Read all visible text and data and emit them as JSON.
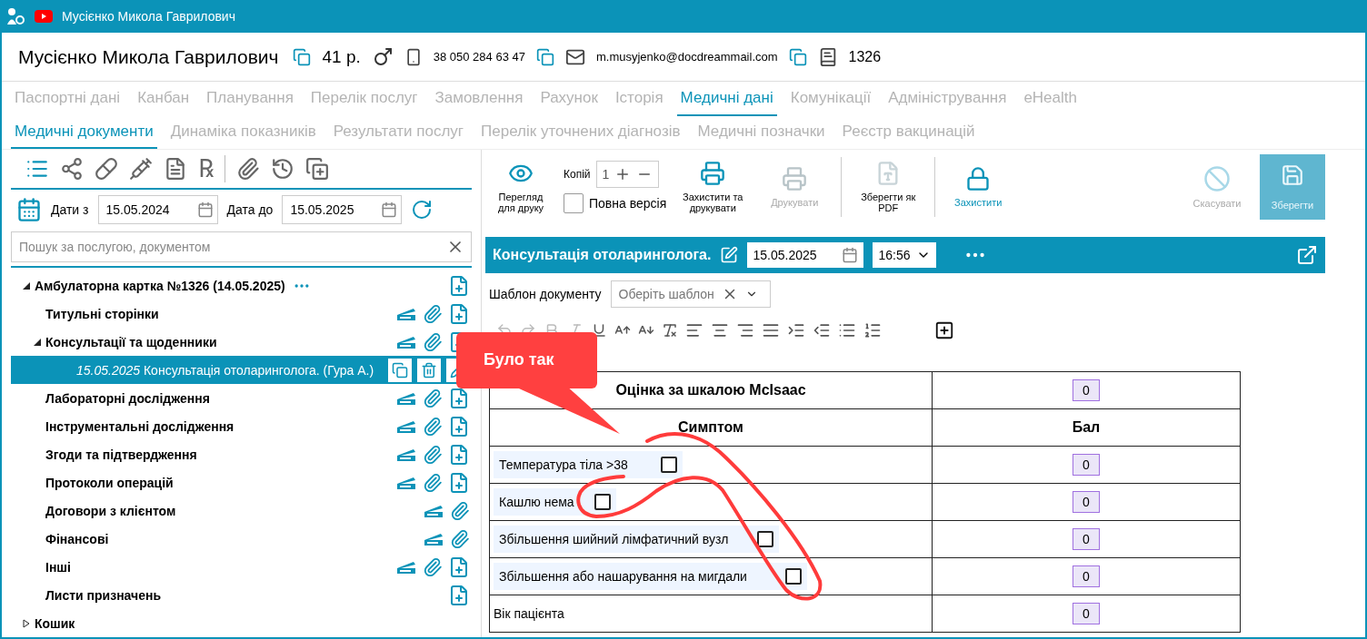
{
  "window": {
    "title": "Мусієнко Микола Гаврилович"
  },
  "patient": {
    "name": "Мусієнко Микола Гаврилович",
    "age": "41 р.",
    "phone": "38 050 284 63 47",
    "email": "m.musyjenko@docdreammail.com",
    "card": "1326"
  },
  "tabs": [
    {
      "label": "Паспортні дані",
      "selected": false
    },
    {
      "label": "Канбан",
      "selected": false
    },
    {
      "label": "Планування",
      "selected": false
    },
    {
      "label": "Перелік послуг",
      "selected": false
    },
    {
      "label": "Замовлення",
      "selected": false
    },
    {
      "label": "Рахунок",
      "selected": false
    },
    {
      "label": "Історія",
      "selected": false
    },
    {
      "label": "Медичні дані",
      "selected": true
    },
    {
      "label": "Комунікації",
      "selected": false
    },
    {
      "label": "Адміністрування",
      "selected": false
    },
    {
      "label": "eHealth",
      "selected": false
    }
  ],
  "subtabs": [
    {
      "label": "Медичні документи",
      "selected": true
    },
    {
      "label": "Динаміка показників",
      "selected": false
    },
    {
      "label": "Результати послуг",
      "selected": false
    },
    {
      "label": "Перелік уточнених діагнозів",
      "selected": false
    },
    {
      "label": "Медичні позначки",
      "selected": false
    },
    {
      "label": "Реєстр вакцинацій",
      "selected": false
    }
  ],
  "left_toolbar": {
    "prescription_symbol": "℞"
  },
  "date_filter": {
    "from_label": "Дати з",
    "from": "15.05.2024",
    "to_label": "Дата до",
    "to": "15.05.2025"
  },
  "search": {
    "placeholder": "Пошук за послугою, документом"
  },
  "tree": [
    {
      "kind": "root",
      "label": "Амбулаторна картка №1326 (14.05.2025)",
      "expanded": true,
      "selected": false,
      "children": [
        {
          "kind": "category",
          "label": "Титульні сторінки",
          "selected": false
        },
        {
          "kind": "category",
          "label": "Консультації та щоденники",
          "selected": false,
          "expanded": true,
          "children": [
            {
              "kind": "record",
              "date": "15.05.2025",
              "label": "Консультація отоларинголога. (Гура А.)",
              "selected": true
            }
          ]
        },
        {
          "kind": "category",
          "label": "Лабораторні дослідження",
          "selected": false
        },
        {
          "kind": "category",
          "label": "Інструментальні дослідження",
          "selected": false
        },
        {
          "kind": "category",
          "label": "Згоди та підтвердження",
          "selected": false
        },
        {
          "kind": "category",
          "label": "Протоколи операцій",
          "selected": false
        },
        {
          "kind": "archive",
          "label": "Договори з клієнтом",
          "selected": false
        },
        {
          "kind": "archive",
          "label": "Фінансові",
          "selected": false
        },
        {
          "kind": "category",
          "label": "Інші",
          "selected": false
        },
        {
          "kind": "list",
          "label": "Листи призначень",
          "selected": false
        }
      ]
    },
    {
      "kind": "trash",
      "label": "Кошик",
      "expanded": false,
      "selected": false
    }
  ],
  "doc_toolbar": {
    "preview": {
      "label": "Перегляд для друку",
      "disabled": false
    },
    "copies": {
      "label": "Копій",
      "value": "1"
    },
    "full_version": {
      "label": "Повна версія",
      "checked": false
    },
    "actions": [
      {
        "kind": "protect_print",
        "label": "Захистити та друкувати",
        "disabled": false
      },
      {
        "kind": "print",
        "label": "Друкувати",
        "disabled": true
      },
      {
        "kind": "pdf",
        "label": "Зберегти як PDF",
        "disabled": false
      },
      {
        "kind": "lock",
        "label": "Захистити",
        "disabled": false
      }
    ],
    "cancel": {
      "label": "Скасувати",
      "disabled": true
    },
    "save": {
      "label": "Зберегти",
      "disabled": true
    }
  },
  "document": {
    "title": "Консультація отоларинголога.",
    "date": "15.05.2025",
    "time": "16:56"
  },
  "template": {
    "label": "Шаблон документу",
    "placeholder": "Оберіть шаблон"
  },
  "table": {
    "title": "Оцінка за шкалою McIsaac",
    "title_score": "0",
    "columns": [
      "Симптом",
      "Бал"
    ],
    "rows": [
      {
        "kind": "checkbox",
        "label": "Температура тіла >38",
        "checked": false,
        "score": "0"
      },
      {
        "kind": "checkbox",
        "label": "Кашлю нема",
        "checked": false,
        "score": "0"
      },
      {
        "kind": "checkbox",
        "label": "Збільшення шийний лімфатичний вузл",
        "checked": false,
        "score": "0"
      },
      {
        "kind": "checkbox",
        "label": "Збільшення або нашарування на мигдали",
        "checked": false,
        "score": "0"
      },
      {
        "kind": "text",
        "label": "Вік пацієнта",
        "score": "0"
      }
    ]
  },
  "callout": {
    "text": "Було так"
  }
}
